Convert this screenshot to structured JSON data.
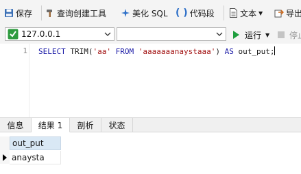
{
  "toolbar": {
    "save_label": "保存",
    "query_builder_label": "查询创建工具",
    "beautify_sql_label": "美化 SQL",
    "code_snippet_label": "代码段",
    "text_label": "文本",
    "export_label": "导出"
  },
  "connection": {
    "host_value": "127.0.0.1",
    "database_value": "",
    "run_label": "运行",
    "stop_label": "停止"
  },
  "editor": {
    "line_number": "1",
    "sql": {
      "kw_select": "SELECT",
      "func_trim": " TRIM(",
      "str_aa": "'aa'",
      "kw_from": " FROM ",
      "str_value": "'aaaaaaanaystaaa'",
      "close_paren": ")",
      "kw_as": " AS ",
      "alias": "out_put;"
    }
  },
  "tabs": [
    {
      "label": "信息"
    },
    {
      "label": "结果 1"
    },
    {
      "label": "剖析"
    },
    {
      "label": "状态"
    }
  ],
  "result": {
    "columns": [
      "out_put"
    ],
    "rows": [
      [
        "anaysta"
      ]
    ]
  },
  "colors": {
    "keyword": "#1a1aa6",
    "string": "#a31515",
    "header_bg": "#d9e8f5",
    "run_green": "#1e9e3e"
  },
  "icons": {
    "save": "floppy-disk-icon",
    "query_builder": "hammer-icon",
    "beautify": "sparkle-icon",
    "code_snippet": "parentheses-icon",
    "text": "document-icon",
    "export": "export-icon",
    "connection": "connection-icon",
    "run": "play-icon",
    "stop": "stop-icon"
  }
}
